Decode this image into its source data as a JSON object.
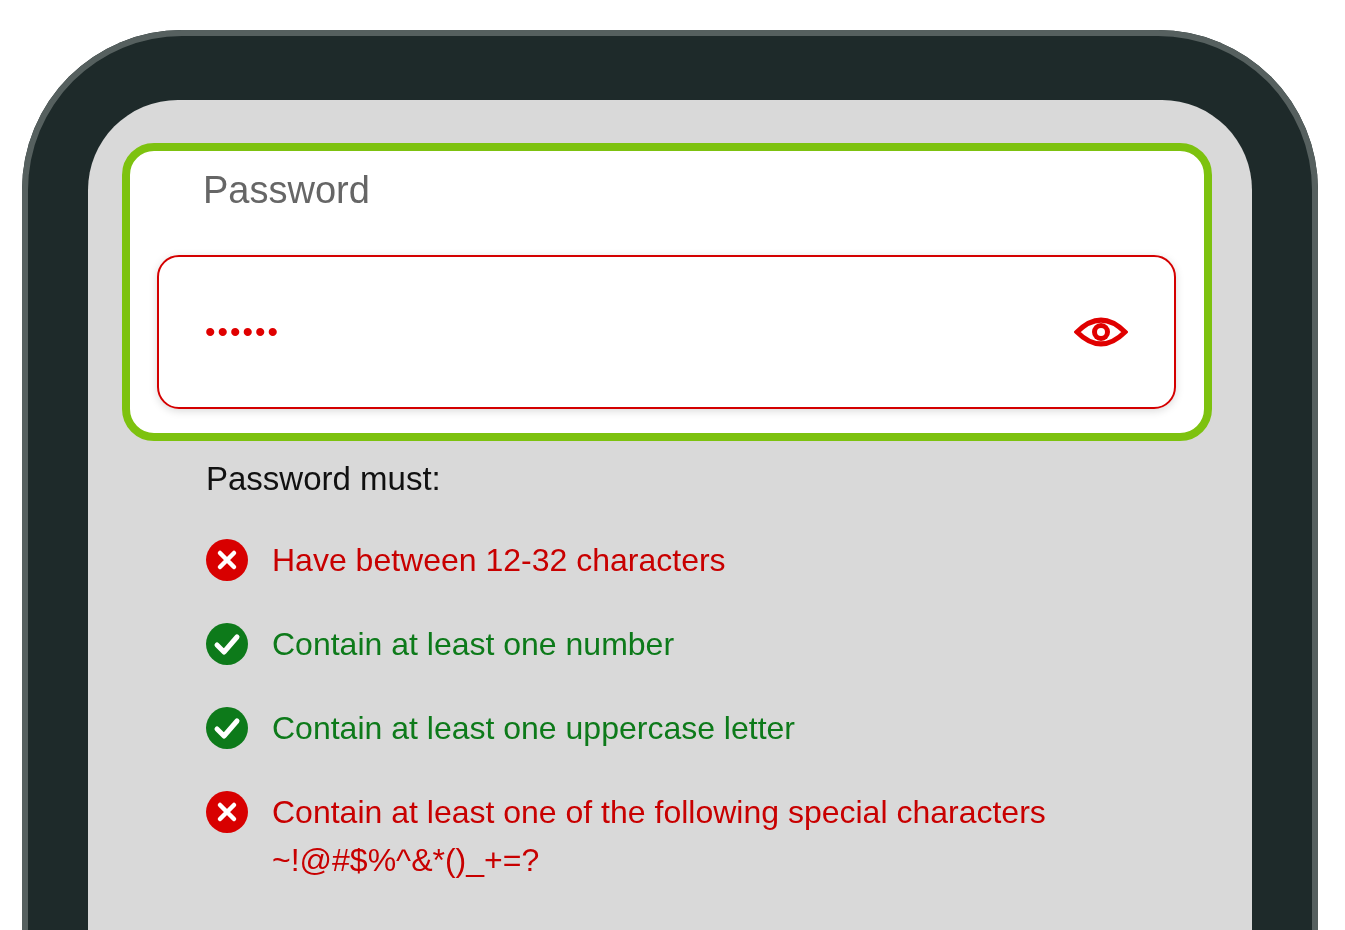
{
  "password_field": {
    "label": "Password",
    "value": "••••••",
    "highlighted": true,
    "invalid": true
  },
  "requirements": {
    "heading": "Password must:",
    "rules": [
      {
        "text": "Have between 12-32 characters",
        "met": false
      },
      {
        "text": "Contain at least one number",
        "met": true
      },
      {
        "text": "Contain at least one uppercase letter",
        "met": true
      },
      {
        "text": "Contain at least one of the following special characters",
        "detail": "~!@#$%^&*()_+=?",
        "met": false
      }
    ]
  }
}
